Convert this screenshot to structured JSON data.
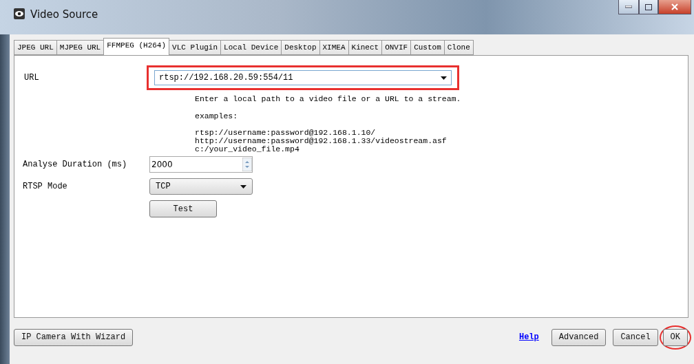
{
  "window": {
    "title": "Video Source"
  },
  "tabs": [
    {
      "label": "JPEG URL",
      "selected": false
    },
    {
      "label": "MJPEG URL",
      "selected": false
    },
    {
      "label": "FFMPEG (H264)",
      "selected": true
    },
    {
      "label": "VLC Plugin",
      "selected": false
    },
    {
      "label": "Local Device",
      "selected": false
    },
    {
      "label": "Desktop",
      "selected": false
    },
    {
      "label": "XIMEA",
      "selected": false
    },
    {
      "label": "Kinect",
      "selected": false
    },
    {
      "label": "ONVIF",
      "selected": false
    },
    {
      "label": "Custom",
      "selected": false
    },
    {
      "label": "Clone",
      "selected": false
    }
  ],
  "url": {
    "label": "URL",
    "value": "rtsp://192.168.20.59:554/11",
    "annotated": true
  },
  "help_text": [
    "Enter a local path to a video file or a URL to a stream.",
    "examples:"
  ],
  "examples": [
    "rtsp://username:password@192.168.1.10/",
    "http://username:password@192.168.1.33/videostream.asf",
    "c:/your_video_file.mp4"
  ],
  "analyse_duration": {
    "label": "Analyse Duration (ms)",
    "value": "2000"
  },
  "rtsp_mode": {
    "label": "RTSP Mode",
    "value": "TCP"
  },
  "test_button": "Test",
  "footer": {
    "wizard_button": "IP Camera With Wizard",
    "help_link": "Help",
    "buttons": [
      {
        "label": "Advanced",
        "annotated": false
      },
      {
        "label": "Cancel",
        "annotated": false
      },
      {
        "label": "OK",
        "annotated": true
      }
    ]
  }
}
